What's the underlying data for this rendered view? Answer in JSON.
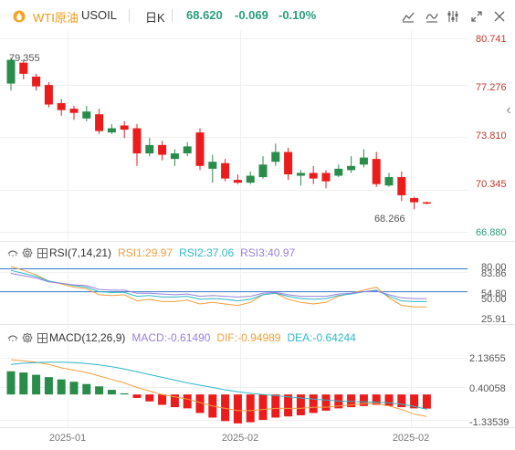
{
  "header": {
    "symbol_name": "WTI原油",
    "symbol_code": "USOIL",
    "timeframe": "日K",
    "price": "68.620",
    "change": "-0.069",
    "change_pct": "-0.10%"
  },
  "toolbar": [
    "draw-tool-icon",
    "indicator-icon",
    "settings-sliders-icon",
    "expand-icon",
    "close-icon"
  ],
  "collapse_arrow": "‹",
  "colors": {
    "up": "#ea1c1c",
    "down": "#2a8c4a",
    "accent": "#f09a18",
    "green_text": "#2a9d7c",
    "rsi1": "#f0a040",
    "rsi2": "#2fb8c8",
    "rsi3": "#9b7fe0",
    "macd_line": "#2fb8c8",
    "signal_line": "#f0a040"
  },
  "rsi_legend": {
    "name": "RSI(7,14,21)",
    "rsi1": "RSI1:29.97",
    "rsi2": "RSI2:37.06",
    "rsi3": "RSI3:40.97"
  },
  "macd_legend": {
    "name": "MACD(12,26,9)",
    "macd": "MACD:-0.61490",
    "dif": "DIF:-0.94989",
    "dea": "DEA:-0.64244"
  },
  "chart_data": [
    {
      "type": "candlestick",
      "title": "WTI原油 USOIL 日K",
      "y_axis_ticks": [
        "80.741",
        "77.276",
        "73.810",
        "70.345",
        "66.880"
      ],
      "ylim": [
        66.88,
        80.741
      ],
      "annotations": {
        "high": "79.355",
        "low": "68.266"
      },
      "x_ticks": [
        "2025-01",
        "2025-02",
        "2025-02"
      ],
      "candles": [
        {
          "o": 77.5,
          "c": 79.2,
          "h": 79.355,
          "l": 77.0
        },
        {
          "o": 79.0,
          "c": 78.2,
          "h": 79.2,
          "l": 77.8
        },
        {
          "o": 78.0,
          "c": 77.3,
          "h": 78.2,
          "l": 77.0
        },
        {
          "o": 77.4,
          "c": 76.0,
          "h": 77.6,
          "l": 75.8
        },
        {
          "o": 76.1,
          "c": 75.6,
          "h": 76.4,
          "l": 75.2
        },
        {
          "o": 75.7,
          "c": 75.4,
          "h": 75.9,
          "l": 74.9
        },
        {
          "o": 75.0,
          "c": 75.5,
          "h": 75.9,
          "l": 74.8
        },
        {
          "o": 75.3,
          "c": 74.1,
          "h": 75.7,
          "l": 73.9
        },
        {
          "o": 74.0,
          "c": 74.3,
          "h": 74.6,
          "l": 73.9
        },
        {
          "o": 74.5,
          "c": 74.2,
          "h": 74.8,
          "l": 73.6
        },
        {
          "o": 74.3,
          "c": 72.5,
          "h": 74.6,
          "l": 71.6
        },
        {
          "o": 72.5,
          "c": 73.1,
          "h": 73.6,
          "l": 72.3
        },
        {
          "o": 73.1,
          "c": 72.4,
          "h": 73.4,
          "l": 72.0
        },
        {
          "o": 72.1,
          "c": 72.5,
          "h": 72.8,
          "l": 71.6
        },
        {
          "o": 72.5,
          "c": 73.0,
          "h": 73.3,
          "l": 72.3
        },
        {
          "o": 74.0,
          "c": 71.6,
          "h": 74.3,
          "l": 71.3
        },
        {
          "o": 71.4,
          "c": 71.9,
          "h": 72.4,
          "l": 70.4
        },
        {
          "o": 71.8,
          "c": 70.7,
          "h": 72.1,
          "l": 70.5
        },
        {
          "o": 70.6,
          "c": 70.4,
          "h": 71.0,
          "l": 70.3
        },
        {
          "o": 70.4,
          "c": 70.9,
          "h": 71.2,
          "l": 70.3
        },
        {
          "o": 70.8,
          "c": 71.7,
          "h": 72.3,
          "l": 70.7
        },
        {
          "o": 71.9,
          "c": 72.6,
          "h": 73.2,
          "l": 71.6
        },
        {
          "o": 72.6,
          "c": 71.0,
          "h": 72.9,
          "l": 70.6
        },
        {
          "o": 70.9,
          "c": 71.1,
          "h": 71.3,
          "l": 70.2
        },
        {
          "o": 71.1,
          "c": 70.7,
          "h": 71.6,
          "l": 70.3
        },
        {
          "o": 71.1,
          "c": 70.5,
          "h": 71.3,
          "l": 70.0
        },
        {
          "o": 70.9,
          "c": 71.4,
          "h": 71.7,
          "l": 70.8
        },
        {
          "o": 71.3,
          "c": 71.6,
          "h": 72.3,
          "l": 71.1
        },
        {
          "o": 71.7,
          "c": 72.2,
          "h": 72.8,
          "l": 71.5
        },
        {
          "o": 72.1,
          "c": 70.3,
          "h": 72.6,
          "l": 70.1
        },
        {
          "o": 70.2,
          "c": 70.8,
          "h": 71.1,
          "l": 70.1
        },
        {
          "o": 70.8,
          "c": 69.5,
          "h": 71.2,
          "l": 69.1
        },
        {
          "o": 69.3,
          "c": 69.0,
          "h": 69.4,
          "l": 68.5
        },
        {
          "o": 69.0,
          "c": 68.9,
          "h": 69.05,
          "l": 68.85
        }
      ]
    },
    {
      "type": "line",
      "title": "RSI(7,14,21)",
      "y_axis_ticks": [
        "80.00",
        "83.86",
        "54.80",
        "50.00",
        "25.91"
      ],
      "reference_lines": [
        80,
        50
      ],
      "series": [
        {
          "name": "RSI1",
          "values": [
            83,
            78,
            72,
            64,
            60,
            56,
            54,
            46,
            45,
            46,
            38,
            40,
            37,
            37,
            39,
            34,
            36,
            34,
            32,
            36,
            46,
            48,
            40,
            36,
            34,
            36,
            44,
            48,
            52,
            56,
            42,
            32,
            30,
            30
          ]
        },
        {
          "name": "RSI2",
          "values": [
            78,
            74,
            70,
            64,
            61,
            58,
            56,
            50,
            49,
            49,
            44,
            45,
            43,
            43,
            44,
            40,
            41,
            40,
            38,
            40,
            46,
            48,
            44,
            41,
            40,
            41,
            45,
            47,
            50,
            52,
            44,
            38,
            37,
            37
          ]
        },
        {
          "name": "RSI3",
          "values": [
            74,
            71,
            68,
            63,
            61,
            59,
            58,
            53,
            52,
            52,
            48,
            48,
            47,
            46,
            47,
            44,
            45,
            44,
            43,
            44,
            48,
            49,
            46,
            44,
            44,
            44,
            47,
            48,
            50,
            51,
            46,
            42,
            41,
            41
          ]
        }
      ]
    },
    {
      "type": "bar",
      "title": "MACD(12,26,9)",
      "y_axis_ticks": [
        "2.13655",
        "0.40058",
        "-1.33539"
      ],
      "ylim": [
        -1.33539,
        2.13655
      ],
      "series": [
        {
          "name": "MACD",
          "values": [
            1.0,
            0.95,
            0.85,
            0.75,
            0.65,
            0.55,
            0.45,
            0.35,
            0.2,
            0.05,
            -0.15,
            -0.3,
            -0.45,
            -0.55,
            -0.6,
            -0.8,
            -1.0,
            -1.15,
            -1.25,
            -1.2,
            -1.1,
            -1.0,
            -0.95,
            -0.9,
            -0.8,
            -0.7,
            -0.6,
            -0.55,
            -0.5,
            -0.45,
            -0.5,
            -0.55,
            -0.6,
            -0.61
          ]
        },
        {
          "name": "DIF",
          "values": [
            1.5,
            1.45,
            1.4,
            1.3,
            1.15,
            1.05,
            0.95,
            0.8,
            0.65,
            0.5,
            0.3,
            0.15,
            0.0,
            -0.1,
            -0.2,
            -0.35,
            -0.5,
            -0.6,
            -0.7,
            -0.7,
            -0.65,
            -0.6,
            -0.6,
            -0.6,
            -0.55,
            -0.55,
            -0.5,
            -0.45,
            -0.4,
            -0.4,
            -0.5,
            -0.65,
            -0.85,
            -0.95
          ]
        },
        {
          "name": "DEA",
          "values": [
            1.3,
            1.35,
            1.38,
            1.4,
            1.4,
            1.38,
            1.34,
            1.28,
            1.2,
            1.1,
            0.98,
            0.86,
            0.74,
            0.62,
            0.5,
            0.4,
            0.3,
            0.2,
            0.12,
            0.05,
            0.0,
            -0.05,
            -0.1,
            -0.15,
            -0.2,
            -0.24,
            -0.28,
            -0.3,
            -0.32,
            -0.33,
            -0.36,
            -0.42,
            -0.52,
            -0.64
          ]
        }
      ]
    }
  ]
}
